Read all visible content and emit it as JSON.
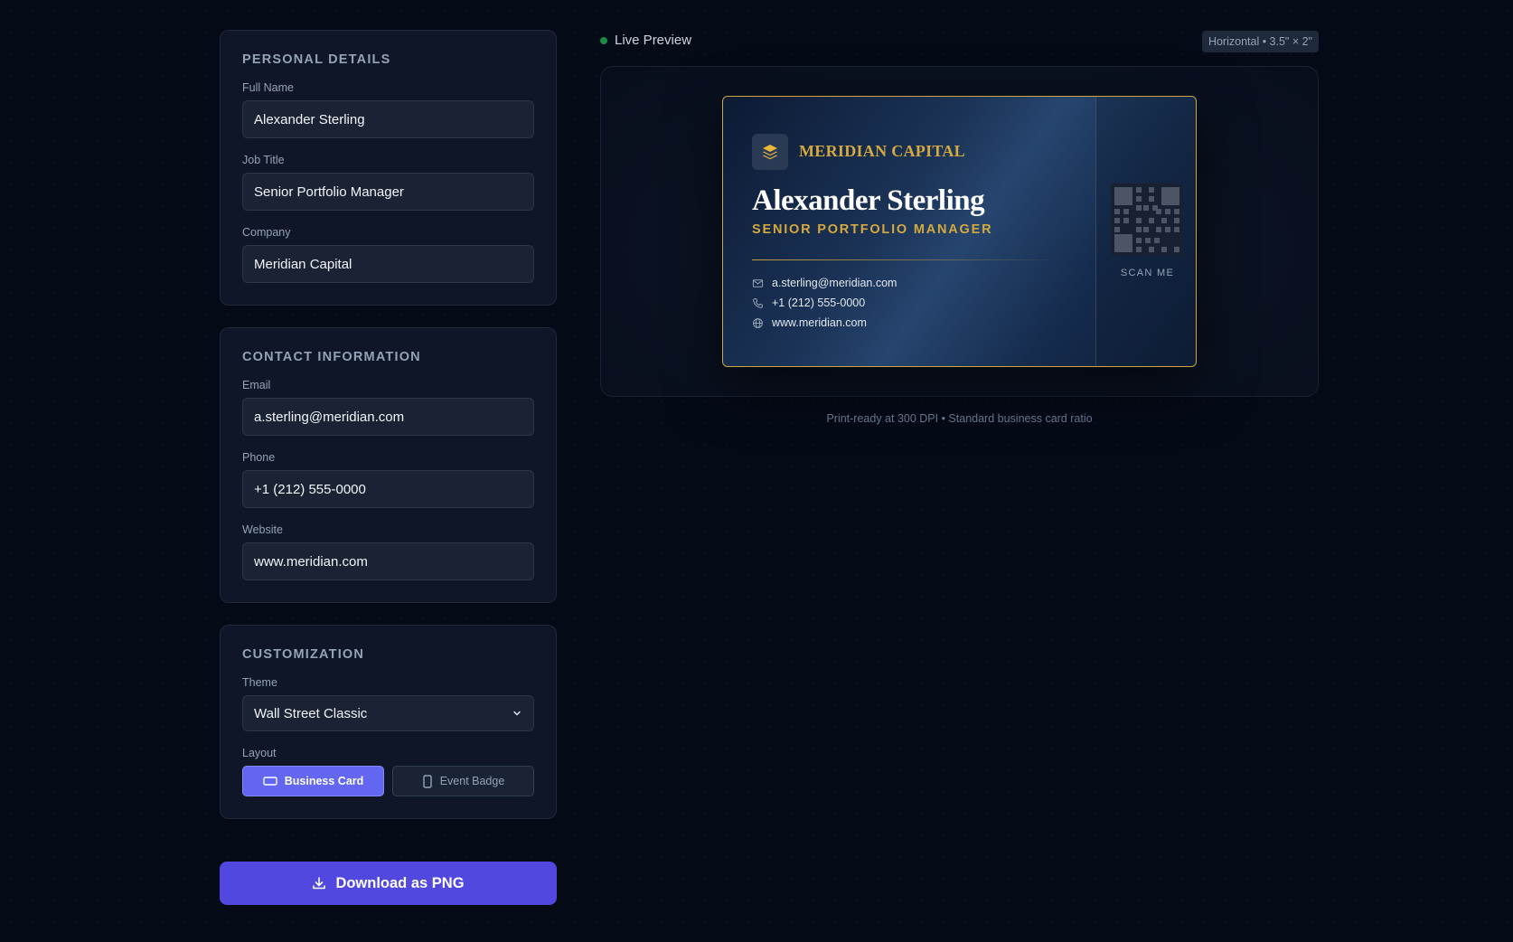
{
  "personal": {
    "title": "PERSONAL DETAILS",
    "full_name_label": "Full Name",
    "full_name_value": "Alexander Sterling",
    "job_title_label": "Job Title",
    "job_title_value": "Senior Portfolio Manager",
    "company_label": "Company",
    "company_value": "Meridian Capital"
  },
  "contact": {
    "title": "CONTACT INFORMATION",
    "email_label": "Email",
    "email_value": "a.sterling@meridian.com",
    "phone_label": "Phone",
    "phone_value": "+1 (212) 555-0000",
    "website_label": "Website",
    "website_value": "www.meridian.com"
  },
  "customization": {
    "title": "CUSTOMIZATION",
    "theme_label": "Theme",
    "theme_value": "Wall Street Classic",
    "layout_label": "Layout",
    "layout_options": [
      {
        "label": "Business Card",
        "active": true,
        "icon": "card-icon"
      },
      {
        "label": "Event Badge",
        "active": false,
        "icon": "badge-icon"
      }
    ]
  },
  "download": {
    "label": "Download as PNG",
    "icon": "download-icon"
  },
  "preview": {
    "live_label": "Live Preview",
    "orientation_badge": "Horizontal • 3.5\" × 2\"",
    "note": "Print-ready at 300 DPI • Standard business card ratio"
  },
  "card": {
    "company": "MERIDIAN CAPITAL",
    "name": "Alexander Sterling",
    "title": "SENIOR PORTFOLIO MANAGER",
    "email": "a.sterling@meridian.com",
    "phone": "+1 (212) 555-0000",
    "website": "www.meridian.com",
    "scan_label": "SCAN ME"
  },
  "colors": {
    "accent": "#6366f1",
    "download": "#5148e0",
    "gold": "#d4a93e",
    "live": "#22c55e",
    "background": "#050a17"
  }
}
